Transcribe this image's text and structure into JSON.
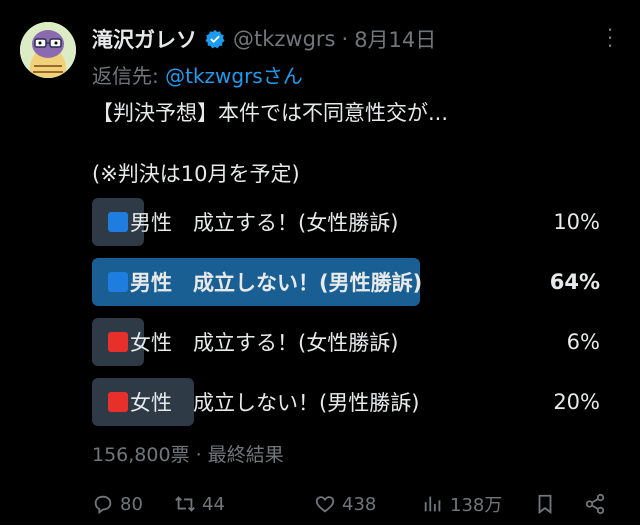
{
  "tweet": {
    "display_name": "滝沢ガレソ",
    "handle": "@tkzwgrs",
    "separator": "·",
    "date": "8月14日",
    "reply_prefix": "返信先: ",
    "reply_mention": "@tkzwgrsさん",
    "text": "【判決予想】本件では不同意性交が...",
    "subtext": "(※判決は10月を予定)"
  },
  "poll": {
    "options": [
      {
        "label": "男性　成立する！(女性勝訴)",
        "percent_text": "10%",
        "percent": 10,
        "marker": "blue",
        "winner": false
      },
      {
        "label": "男性　成立しない！(男性勝訴)",
        "percent_text": "64%",
        "percent": 64,
        "marker": "blue",
        "winner": true
      },
      {
        "label": "女性　成立する！(女性勝訴)",
        "percent_text": "6%",
        "percent": 6,
        "marker": "red",
        "winner": false
      },
      {
        "label": "女性　成立しない！(男性勝訴)",
        "percent_text": "20%",
        "percent": 20,
        "marker": "red",
        "winner": false
      }
    ],
    "votes": "156,800票",
    "meta_separator": " · ",
    "status": "最終結果"
  },
  "actions": {
    "replies": "80",
    "retweets": "44",
    "likes": "438",
    "views": "138万"
  },
  "colors": {
    "accent": "#1d9bf0",
    "winner_bar": "#1a5f93",
    "bar": "#2f3a47",
    "muted": "#71767b"
  },
  "icons": [
    "verified-badge-icon",
    "more-icon",
    "reply-icon",
    "retweet-icon",
    "like-icon",
    "views-icon",
    "bookmark-icon",
    "share-icon"
  ]
}
